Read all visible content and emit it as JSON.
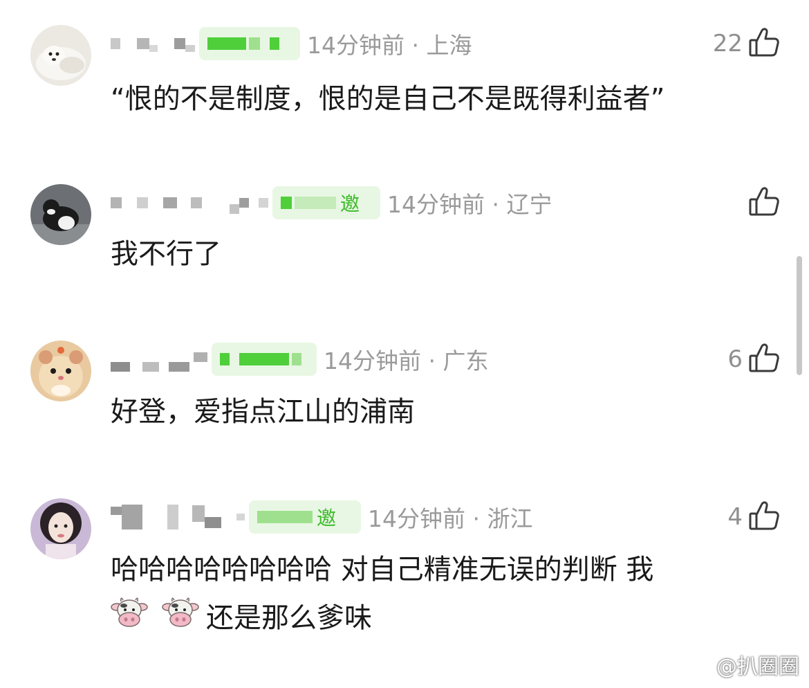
{
  "comments": [
    {
      "time_location": "14分钟前 · 上海",
      "likes": "22",
      "text": "“恨的不是制度，恨的是自己不是既得利益者”",
      "badge_text": ""
    },
    {
      "time_location": "14分钟前 · 辽宁",
      "likes": "",
      "text": "我不行了",
      "badge_text": "邀"
    },
    {
      "time_location": "14分钟前 · 广东",
      "likes": "6",
      "text": "好登，爱指点江山的浦南",
      "badge_text": ""
    },
    {
      "time_location": "14分钟前 · 浙江",
      "likes": "4",
      "text_line1": "哈哈哈哈哈哈哈哈 对自己精准无误的判断 我",
      "text_line2": "还是那么爹味",
      "badge_text": "邀"
    }
  ],
  "watermark": "@扒圈圈",
  "icons": {
    "like": "thumbs-up-icon",
    "emoji": "cow-face-icon",
    "watermark_logo": "weibo-logo-icon"
  },
  "colors": {
    "badge_bg": "#e8f7e3",
    "badge_accent": "#4fcf3a",
    "meta_text": "#9a9a9a"
  }
}
